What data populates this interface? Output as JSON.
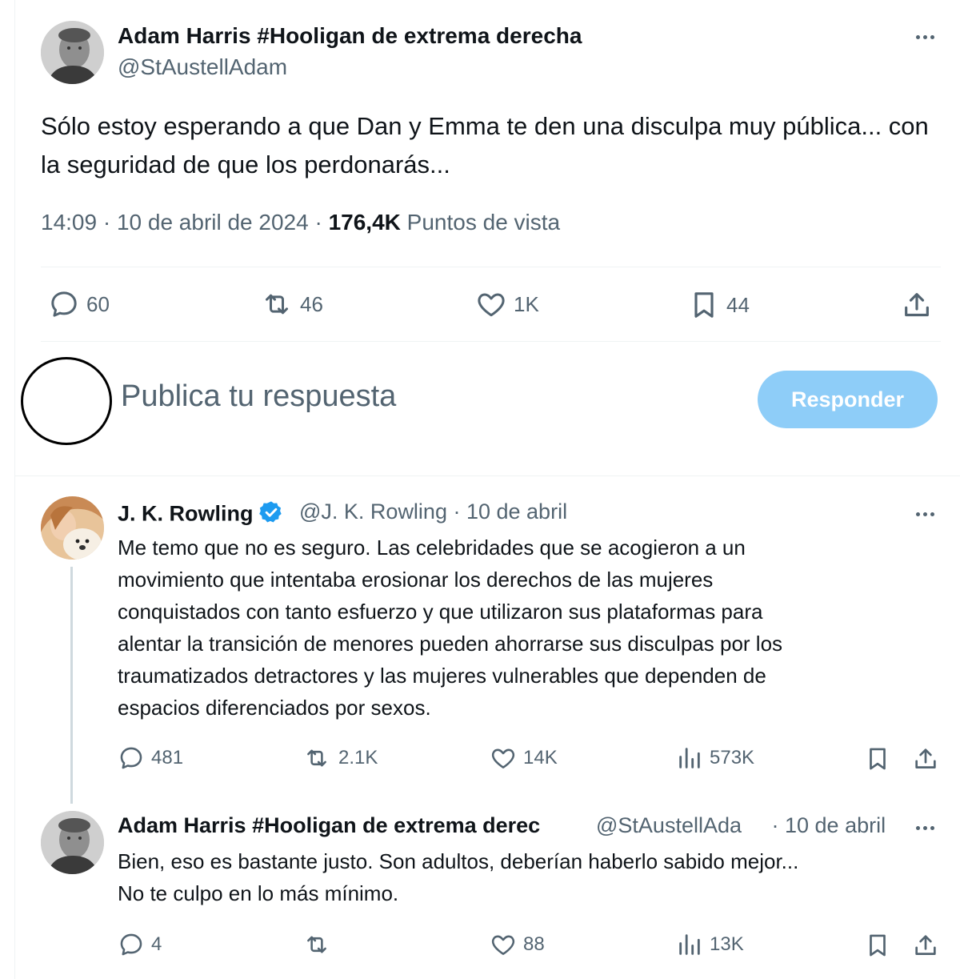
{
  "main_tweet": {
    "author_name": "Adam Harris #Hooligan de extrema derecha",
    "author_handle": "@StAustellAdam",
    "text": "Sólo estoy esperando a que Dan y Emma te den una disculpa muy pública... con la seguridad de que los perdonarás...",
    "time": "14:09 · 10 de abril de 2024 · ",
    "views_count": "176,4K",
    "views_label": " Puntos de vista",
    "actions": {
      "replies": "60",
      "retweets": "46",
      "likes": "1K",
      "bookmarks": "44"
    }
  },
  "compose": {
    "placeholder": "Publica tu respuesta",
    "button": "Responder"
  },
  "replies": [
    {
      "author_name": "J. K. Rowling",
      "author_handle": "@J. K. Rowling",
      "date": "· 10 de abril",
      "verified": true,
      "lines": [
        "Me temo que no es seguro. Las celebridades que se acogieron a un",
        "movimiento que intentaba erosionar los derechos de las mujeres",
        "conquistados con tanto esfuerzo y que utilizaron sus plataformas para",
        "alentar la transición de menores pueden ahorrarse sus disculpas por los",
        "traumatizados detractores y las mujeres vulnerables que dependen de",
        "espacios diferenciados por sexos."
      ],
      "actions": {
        "replies": "481",
        "retweets": "2.1K",
        "likes": "14K",
        "views": "573K"
      }
    },
    {
      "author_name": "Adam Harris #Hooligan de extrema derec",
      "author_handle": "@StAustellAda",
      "date": "· 10 de abril",
      "lines": [
        "Bien, eso es bastante justo. Son adultos, deberían haberlo sabido mejor...",
        "No te culpo en lo más mínimo."
      ],
      "actions": {
        "replies": "4",
        "retweets": "",
        "likes": "88",
        "views": "13K"
      }
    }
  ],
  "colors": {
    "text": "#0f1419",
    "secondary": "#536471",
    "accent_button": "#8ecdf8",
    "verified": "#1d9bf0"
  },
  "icons": [
    "more-icon",
    "reply-icon",
    "retweet-icon",
    "like-icon",
    "bookmark-icon",
    "share-icon",
    "views-icon",
    "verified-icon"
  ]
}
